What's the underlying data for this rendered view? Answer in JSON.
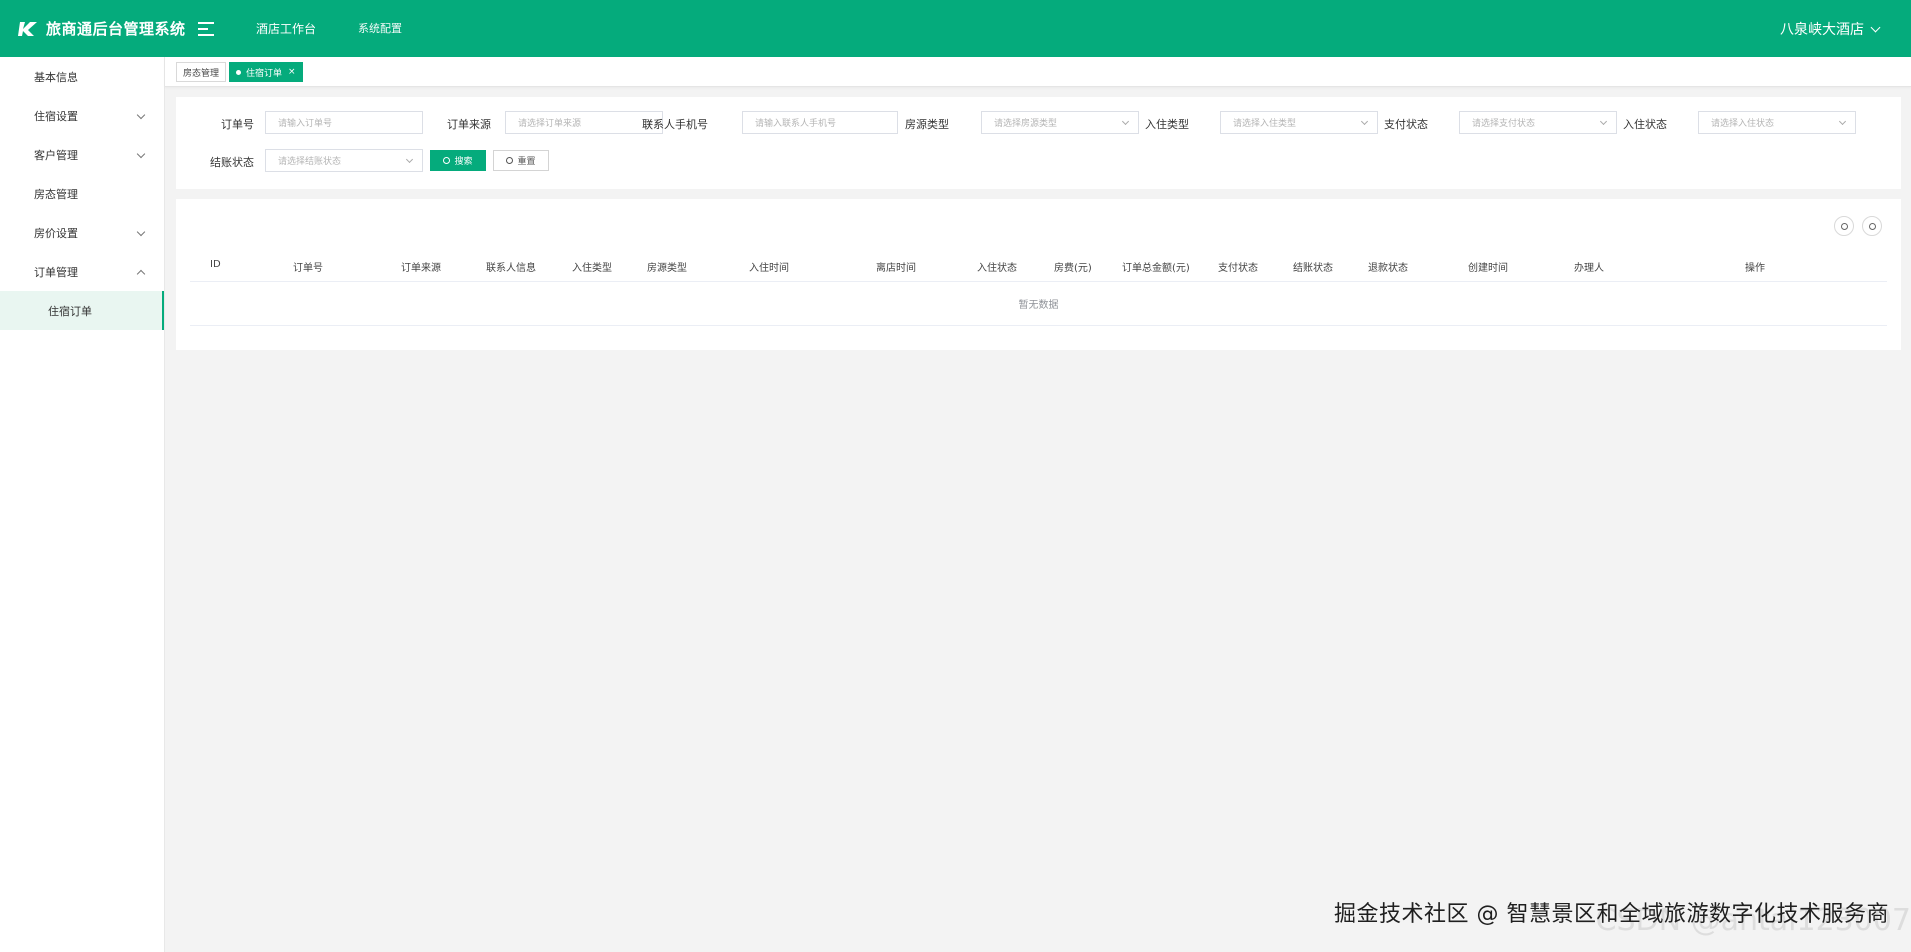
{
  "header": {
    "title": "旅商通后台管理系统",
    "nav": [
      "酒店工作台",
      "系统配置"
    ],
    "hotel": "八泉峡大酒店"
  },
  "sidebar": {
    "items": [
      {
        "label": "基本信息"
      },
      {
        "label": "住宿设置"
      },
      {
        "label": "客户管理"
      },
      {
        "label": "房态管理"
      },
      {
        "label": "房价设置"
      },
      {
        "label": "订单管理"
      },
      {
        "label": "住宿订单"
      }
    ]
  },
  "tabs": [
    {
      "label": "房态管理"
    },
    {
      "label": "住宿订单",
      "close": "×"
    }
  ],
  "filters": {
    "order_no": {
      "label": "订单号",
      "placeholder": "请输入订单号"
    },
    "source": {
      "label": "订单来源",
      "placeholder": "请选择订单来源"
    },
    "phone": {
      "label": "联系人手机号",
      "placeholder": "请输入联系人手机号"
    },
    "room_type": {
      "label": "房源类型",
      "placeholder": "请选择房源类型"
    },
    "checkin_type": {
      "label": "入住类型",
      "placeholder": "请选择入住类型"
    },
    "pay_status": {
      "label": "支付状态",
      "placeholder": "请选择支付状态"
    },
    "checkin_status": {
      "label": "入住状态",
      "placeholder": "请选择入住状态"
    },
    "settle_status": {
      "label": "结账状态",
      "placeholder": "请选择结账状态"
    },
    "search_label": "搜索",
    "reset_label": "重置"
  },
  "table": {
    "columns": [
      "ID",
      "订单号",
      "订单来源",
      "联系人信息",
      "入住类型",
      "房源类型",
      "入住时间",
      "离店时间",
      "入住状态",
      "房费(元)",
      "订单总金额(元)",
      "支付状态",
      "结账状态",
      "退款状态",
      "创建时间",
      "办理人",
      "操作"
    ],
    "empty_text": "暂无数据"
  },
  "watermark": {
    "text": "掘金技术社区 @ 智慧景区和全域旅游数字化技术服务商",
    "ghost": "CSDN @antai123007"
  },
  "colors": {
    "brand": "#05ab7c"
  }
}
